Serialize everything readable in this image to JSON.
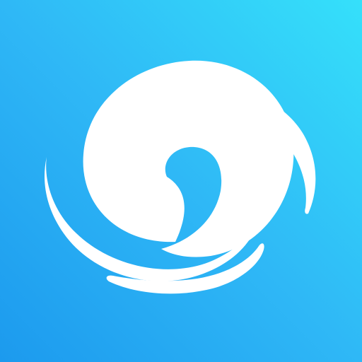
{
  "icon": {
    "semantic": "swirl-logo-icon",
    "colors": {
      "gradient_top_right": "#35E0FA",
      "gradient_mid": "#2FB8F6",
      "gradient_bottom_left": "#1C9AEE",
      "glyph": "#FFFFFF"
    }
  }
}
